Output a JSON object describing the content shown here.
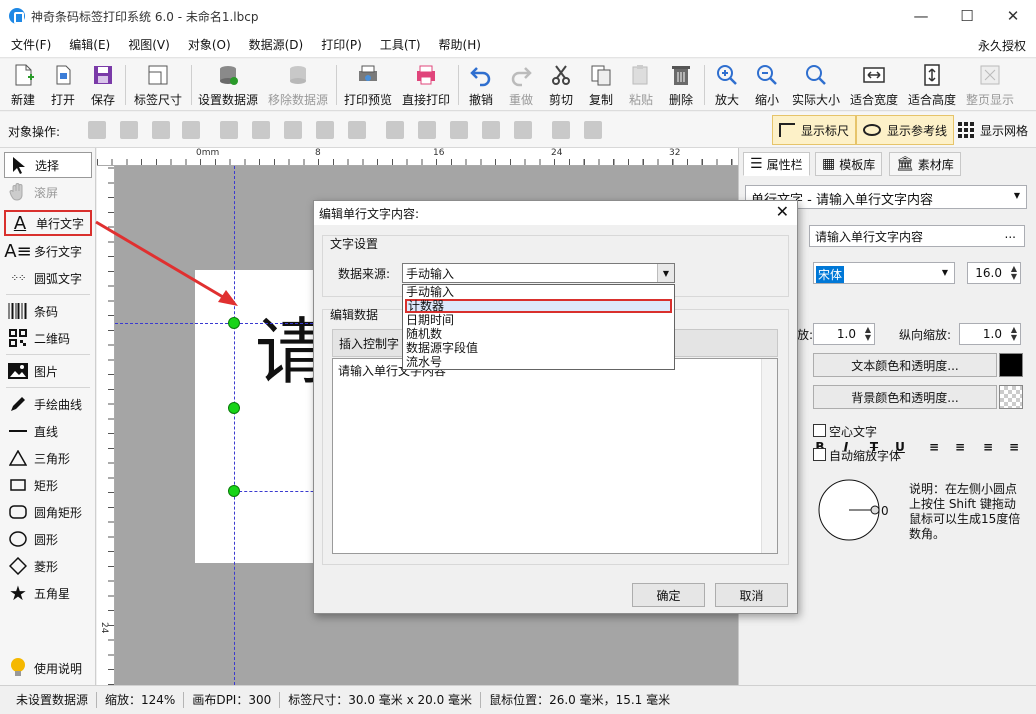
{
  "window": {
    "title": "神奇条码标签打印系统 6.0 - 未命名1.lbcp",
    "min": "—",
    "max": "☐",
    "close": "✕"
  },
  "menu": {
    "items": [
      "文件(F)",
      "编辑(E)",
      "视图(V)",
      "对象(O)",
      "数据源(D)",
      "打印(P)",
      "工具(T)",
      "帮助(H)"
    ],
    "license": "永久授权"
  },
  "toolbar": {
    "new": "新建",
    "open": "打开",
    "save": "保存",
    "label_size": "标签尺寸",
    "set_datasource": "设置数据源",
    "remove_datasource": "移除数据源",
    "print_preview": "打印预览",
    "direct_print": "直接打印",
    "undo": "撤销",
    "redo": "重做",
    "cut": "剪切",
    "copy": "复制",
    "paste": "粘贴",
    "delete": "删除",
    "zoom_in": "放大",
    "zoom_out": "缩小",
    "actual_size": "实际大小",
    "fit_width": "适合宽度",
    "fit_height": "适合高度",
    "page_display": "整页显示"
  },
  "objbar": {
    "label": "对象操作:",
    "show_ruler": "显示标尺",
    "show_guides": "显示参考线",
    "show_grid": "显示网格"
  },
  "tools": {
    "select": "选择",
    "scroll": "滚屏",
    "single_text": "单行文字",
    "multi_text": "多行文字",
    "arc_text": "圆弧文字",
    "barcode": "条码",
    "qrcode": "二维码",
    "image": "图片",
    "freehand": "手绘曲线",
    "line": "直线",
    "triangle": "三角形",
    "rect": "矩形",
    "round_rect": "圆角矩形",
    "ellipse": "圆形",
    "diamond": "菱形",
    "star": "五角星",
    "help": "使用说明"
  },
  "rulers": {
    "h": [
      "0mm",
      "8",
      "16",
      "24",
      "32"
    ],
    "v": [
      "24"
    ]
  },
  "canvas": {
    "text_preview": "请"
  },
  "props": {
    "tabs": [
      "属性栏",
      "模板库",
      "素材库"
    ],
    "object_select": "单行文字 - 请输入单行文字内容",
    "content_value": "请输入单行文字内容",
    "more": "...",
    "font_name": "宋体",
    "font_size": "16.0",
    "hscale_label": "放:",
    "hscale": "1.0",
    "vscale_label": "纵向缩放:",
    "vscale": "1.0",
    "text_color_btn": "文本颜色和透明度...",
    "bg_color_btn": "背景颜色和透明度...",
    "hollow_text": "空心文字",
    "auto_scale_font": "自动缩放字体",
    "angle": "0",
    "note": "说明：在左侧小圆点上按住 Shift 键拖动鼠标可以生成15度倍数角。",
    "fmt_bold": "B",
    "fmt_italic": "I",
    "fmt_strike": "T",
    "fmt_underline": "U"
  },
  "status": {
    "datasource": "未设置数据源",
    "zoom": "缩放：124%",
    "dpi": "画布DPI：300",
    "label_size": "标签尺寸：30.0 毫米 x 20.0 毫米",
    "mouse_pos": "鼠标位置：26.0 毫米，15.1 毫米"
  },
  "dialog": {
    "title": "编辑单行文字内容:",
    "group_text_settings": "文字设置",
    "datasource_label": "数据来源:",
    "datasource_value": "手动输入",
    "options": [
      "手动输入",
      "计数器",
      "日期时间",
      "随机数",
      "数据源字段值",
      "流水号"
    ],
    "selected_option": "计数器",
    "group_edit_data": "编辑数据",
    "insert_ctrl_tab": "插入控制字",
    "text_content": "请输入单行文字内容",
    "ok": "确定",
    "cancel": "取消"
  },
  "colors": {
    "accent_red": "#d9302d",
    "handle_green": "#18d418",
    "guide_blue": "#3a3ad0"
  }
}
